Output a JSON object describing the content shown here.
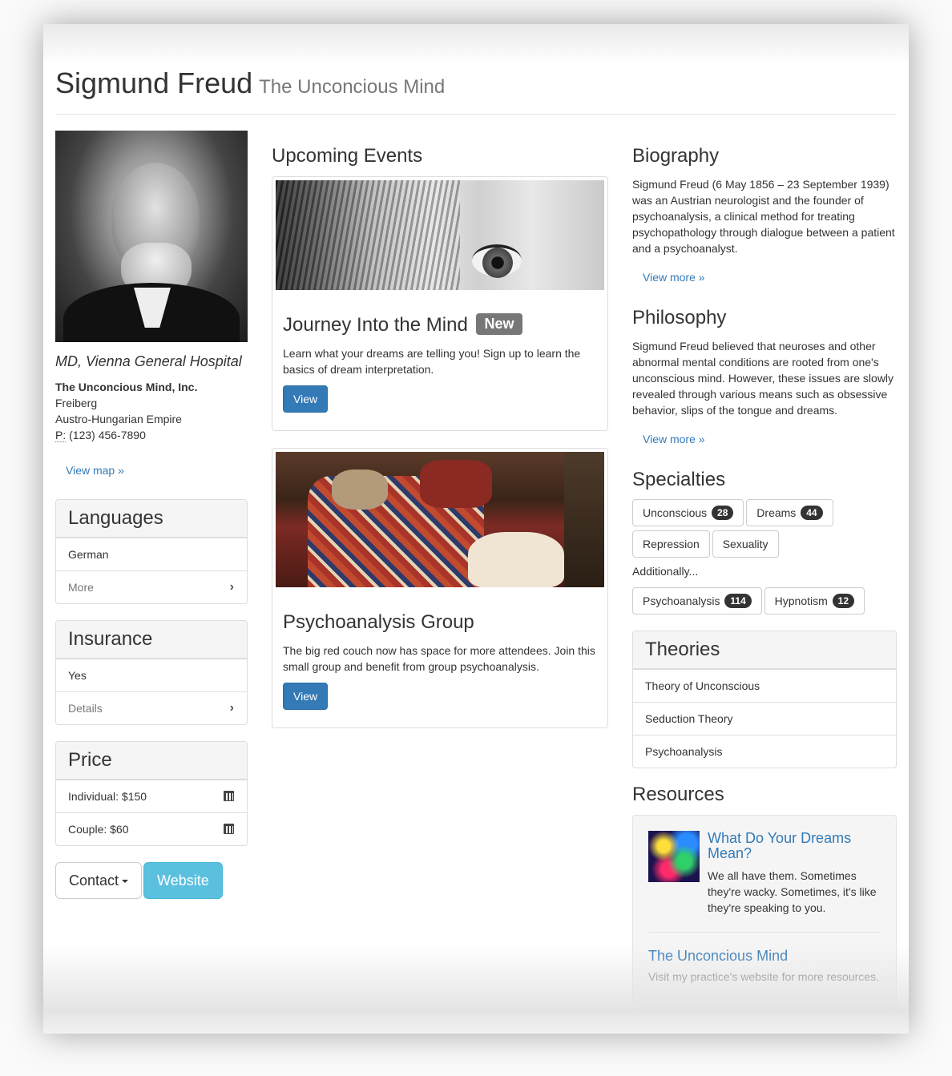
{
  "header": {
    "name": "Sigmund Freud",
    "subtitle": "The Unconcious Mind"
  },
  "profile": {
    "title": "MD, Vienna General Hospital",
    "company": "The Unconcious Mind, Inc.",
    "city": "Freiberg",
    "country": "Austro-Hungarian Empire",
    "phone_label": "P:",
    "phone": "(123) 456-7890",
    "map_link": "View map »"
  },
  "languages": {
    "title": "Languages",
    "items": [
      "German"
    ],
    "more_label": "More"
  },
  "insurance": {
    "title": "Insurance",
    "value": "Yes",
    "details_label": "Details"
  },
  "price": {
    "title": "Price",
    "items": [
      "Individual: $150",
      "Couple: $60"
    ]
  },
  "buttons": {
    "contact": "Contact",
    "website": "Website"
  },
  "events": {
    "title": "Upcoming Events",
    "items": [
      {
        "title": "Journey Into the Mind",
        "badge": "New",
        "text": "Learn what your dreams are telling you! Sign up to learn the basics of dream interpretation.",
        "button": "View"
      },
      {
        "title": "Psychoanalysis Group",
        "badge": "",
        "text": "The big red couch now has space for more attendees. Join this small group and benefit from group psychoanalysis.",
        "button": "View"
      }
    ]
  },
  "biography": {
    "title": "Biography",
    "text": "Sigmund Freud (6 May 1856 – 23 September 1939) was an Austrian neurologist and the founder of psychoanalysis, a clinical method for treating psychopathology through dialogue between a patient and a psychoanalyst.",
    "more": "View more »"
  },
  "philosophy": {
    "title": "Philosophy",
    "text": "Sigmund Freud believed that neuroses and other abnormal mental conditions are rooted from one's unconscious mind. However, these issues are slowly revealed through various means such as obsessive behavior, slips of the tongue and dreams.",
    "more": "View more »"
  },
  "specialties": {
    "title": "Specialties",
    "primary": [
      {
        "label": "Unconscious",
        "count": "28"
      },
      {
        "label": "Dreams",
        "count": "44"
      },
      {
        "label": "Repression",
        "count": ""
      },
      {
        "label": "Sexuality",
        "count": ""
      }
    ],
    "additionally_label": "Additionally...",
    "secondary": [
      {
        "label": "Psychoanalysis",
        "count": "114"
      },
      {
        "label": "Hypnotism",
        "count": "12"
      }
    ]
  },
  "theories": {
    "title": "Theories",
    "items": [
      "Theory of Unconscious",
      "Seduction Theory",
      "Psychoanalysis"
    ]
  },
  "resources": {
    "title": "Resources",
    "feature_title": "What Do Your Dreams Mean?",
    "feature_text": "We all have them. Sometimes they're wacky. Sometimes, it's like they're speaking to you.",
    "site_title": "The Unconcious Mind",
    "site_text": "Visit my practice's website for more resources."
  }
}
